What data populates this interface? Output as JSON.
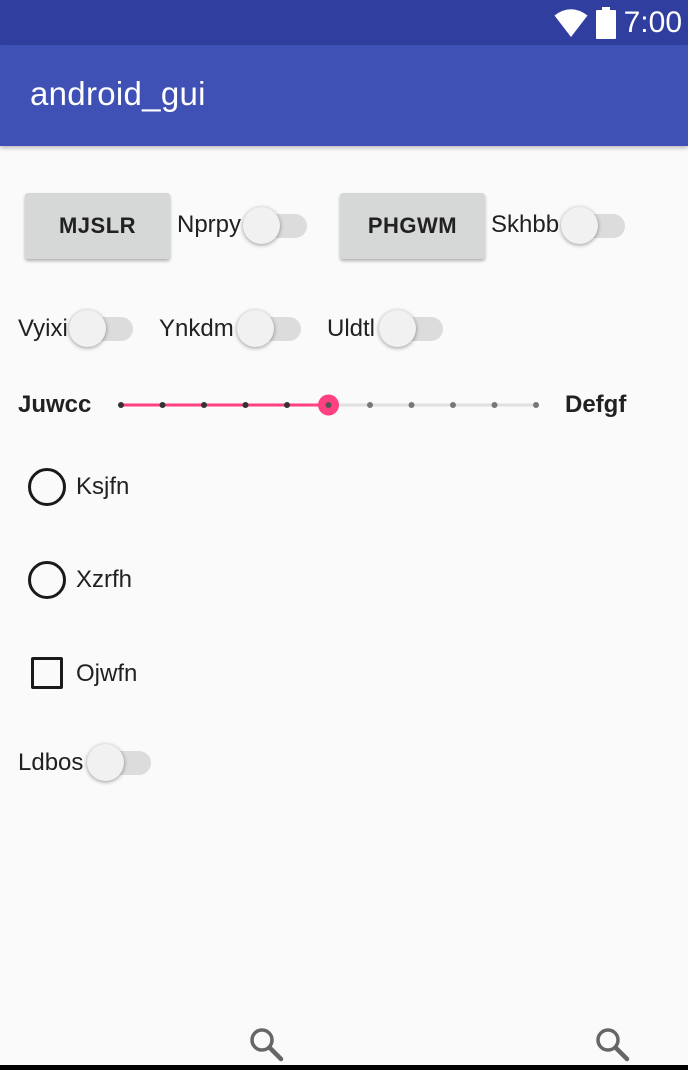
{
  "status_bar": {
    "time": "7:00",
    "icons": [
      "wifi-icon",
      "battery-icon"
    ],
    "color": "#303f9f"
  },
  "app_bar": {
    "title": "android_gui",
    "color": "#3f51b5"
  },
  "row1": {
    "button1_label": "MJSLR",
    "switch1_label": "Nprpy",
    "switch1_on": false,
    "button2_label": "PHGWM",
    "switch2_label": "Skhbb",
    "switch2_on": false
  },
  "row2": {
    "switch1_label": "Vyixi",
    "switch1_on": false,
    "switch2_label": "Ynkdm",
    "switch2_on": false,
    "switch3_label": "Uldtl",
    "switch3_on": false
  },
  "slider": {
    "left_label": "Juwcc",
    "right_label": "Defgf",
    "ticks": 11,
    "value": 5,
    "max": 10,
    "accent": "#ff4081"
  },
  "radios": [
    {
      "label": "Ksjfn",
      "checked": false
    },
    {
      "label": "Xzrfh",
      "checked": false
    }
  ],
  "checkbox": {
    "label": "Ojwfn",
    "checked": false
  },
  "bottom_switch": {
    "label": "Ldbos",
    "on": false
  },
  "bottom_icons": [
    "search-icon",
    "search-icon"
  ]
}
